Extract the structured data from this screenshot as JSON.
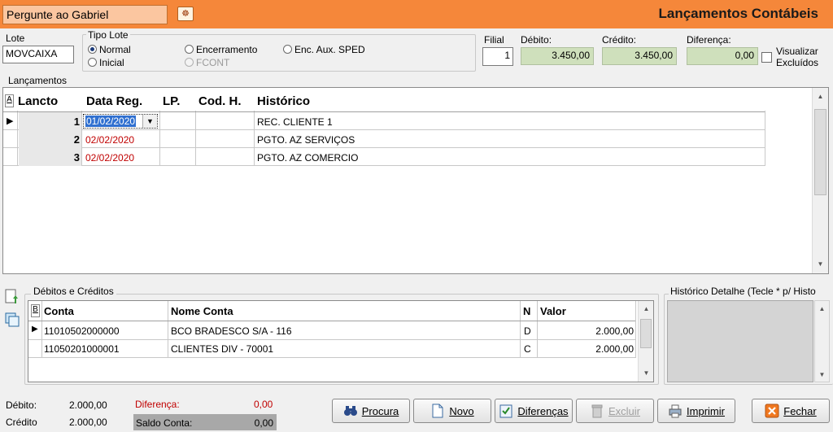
{
  "header": {
    "ask_field": "Pergunte ao Gabriel",
    "title": "Lançamentos Contábeis"
  },
  "form": {
    "lote_label": "Lote",
    "lote_value": "MOVCAIXA",
    "tipo_lote_label": "Tipo Lote",
    "tipo_options": [
      "Normal",
      "Inicial",
      "Encerramento",
      "FCONT",
      "Enc. Aux. SPED"
    ],
    "tipo_selected": "Normal",
    "filial_label": "Filial",
    "filial_value": "1",
    "debito_label": "Débito:",
    "debito_value": "3.450,00",
    "credito_label": "Crédito:",
    "credito_value": "3.450,00",
    "diferenca_label": "Diferença:",
    "diferenca_value": "0,00",
    "visualizar_label_1": "Visualizar",
    "visualizar_label_2": "Excluídos"
  },
  "lancamentos": {
    "label": "Lançamentos",
    "sort_marker": "A",
    "columns": [
      "Lancto",
      "Data Reg.",
      "LP.",
      "Cod. H.",
      "Histórico"
    ],
    "rows": [
      {
        "lancto": "1",
        "data": "01/02/2020",
        "lp": "",
        "cod": "",
        "historico": "REC. CLIENTE 1"
      },
      {
        "lancto": "2",
        "data": "02/02/2020",
        "lp": "",
        "cod": "",
        "historico": "PGTO.  AZ SERVIÇOS"
      },
      {
        "lancto": "3",
        "data": "02/02/2020",
        "lp": "",
        "cod": "",
        "historico": "PGTO. AZ COMERCIO"
      }
    ]
  },
  "debitos": {
    "label": "Débitos e Créditos",
    "sort_marker": "B",
    "columns": [
      "Conta",
      "Nome Conta",
      "N",
      "Valor"
    ],
    "rows": [
      {
        "conta": "11010502000000",
        "nome": "BCO BRADESCO S/A - 116",
        "n": "D",
        "valor": "2.000,00"
      },
      {
        "conta": "11050201000001",
        "nome": "CLIENTES DIV  - 70001",
        "n": "C",
        "valor": "2.000,00"
      }
    ]
  },
  "historico_detalhe": {
    "label": "Histórico Detalhe (Tecle * p/ Histo"
  },
  "footer": {
    "debito_label": "Débito:",
    "debito_value": "2.000,00",
    "credito_label": "Crédito",
    "credito_value": "2.000,00",
    "diferenca_label": "Diferença:",
    "diferenca_value": "0,00",
    "saldo_label": "Saldo Conta:",
    "saldo_value": "0,00"
  },
  "buttons": {
    "procura": "Procura",
    "novo": "Novo",
    "diferencas": "Diferenças",
    "excluir": "Excluir",
    "imprimir": "Imprimir",
    "fechar": "Fechar"
  },
  "colors": {
    "header_bg": "#f5873a",
    "green_field": "#cfe0bc",
    "red_text": "#c00000"
  }
}
